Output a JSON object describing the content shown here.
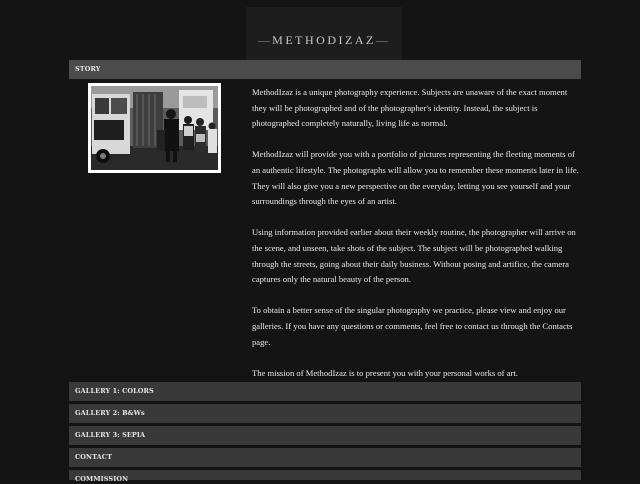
{
  "site": {
    "logo": "METHODIZAZ"
  },
  "story": {
    "header": "STORY",
    "paragraphs": [
      "MethodIzaz is a unique photography experience. Subjects are unaware of the exact moment they will be photographed and of the photographer's identity. Instead, the subject is photographed completely naturally, living life as normal.",
      "MethodIzaz will provide you with a portfolio of pictures representing the fleeting moments of an authentic lifestyle. The photographs will allow you to remember these moments later in life. They will also give you a new perspective on the everyday, letting you see yourself and your surroundings through the eyes of an artist.",
      "Using information provided earlier about their weekly routine, the photographer will arrive on the scene, and unseen, take shots of the subject. The subject will be photographed walking through the streets, going about their daily business. Without posing and artifice, the camera captures only the natural beauty of the person.",
      "To obtain a better sense of the singular photography we practice, please view and enjoy our galleries. If you have any questions or comments, feel free to contact us through the Contacts page.",
      "The mission of MethodIzaz is to present you with your personal works of art."
    ]
  },
  "sections": [
    {
      "label": "GALLERY 1: COLORS"
    },
    {
      "label": "GALLERY 2: B&Ws"
    },
    {
      "label": "GALLERY 3: SEPIA"
    },
    {
      "label": "CONTACT"
    },
    {
      "label": "COMMISSION"
    }
  ],
  "colors": {
    "page_background": "#141414",
    "active_header": "#4a4b4a",
    "header": "#393939",
    "text": "#e9e9e9"
  }
}
